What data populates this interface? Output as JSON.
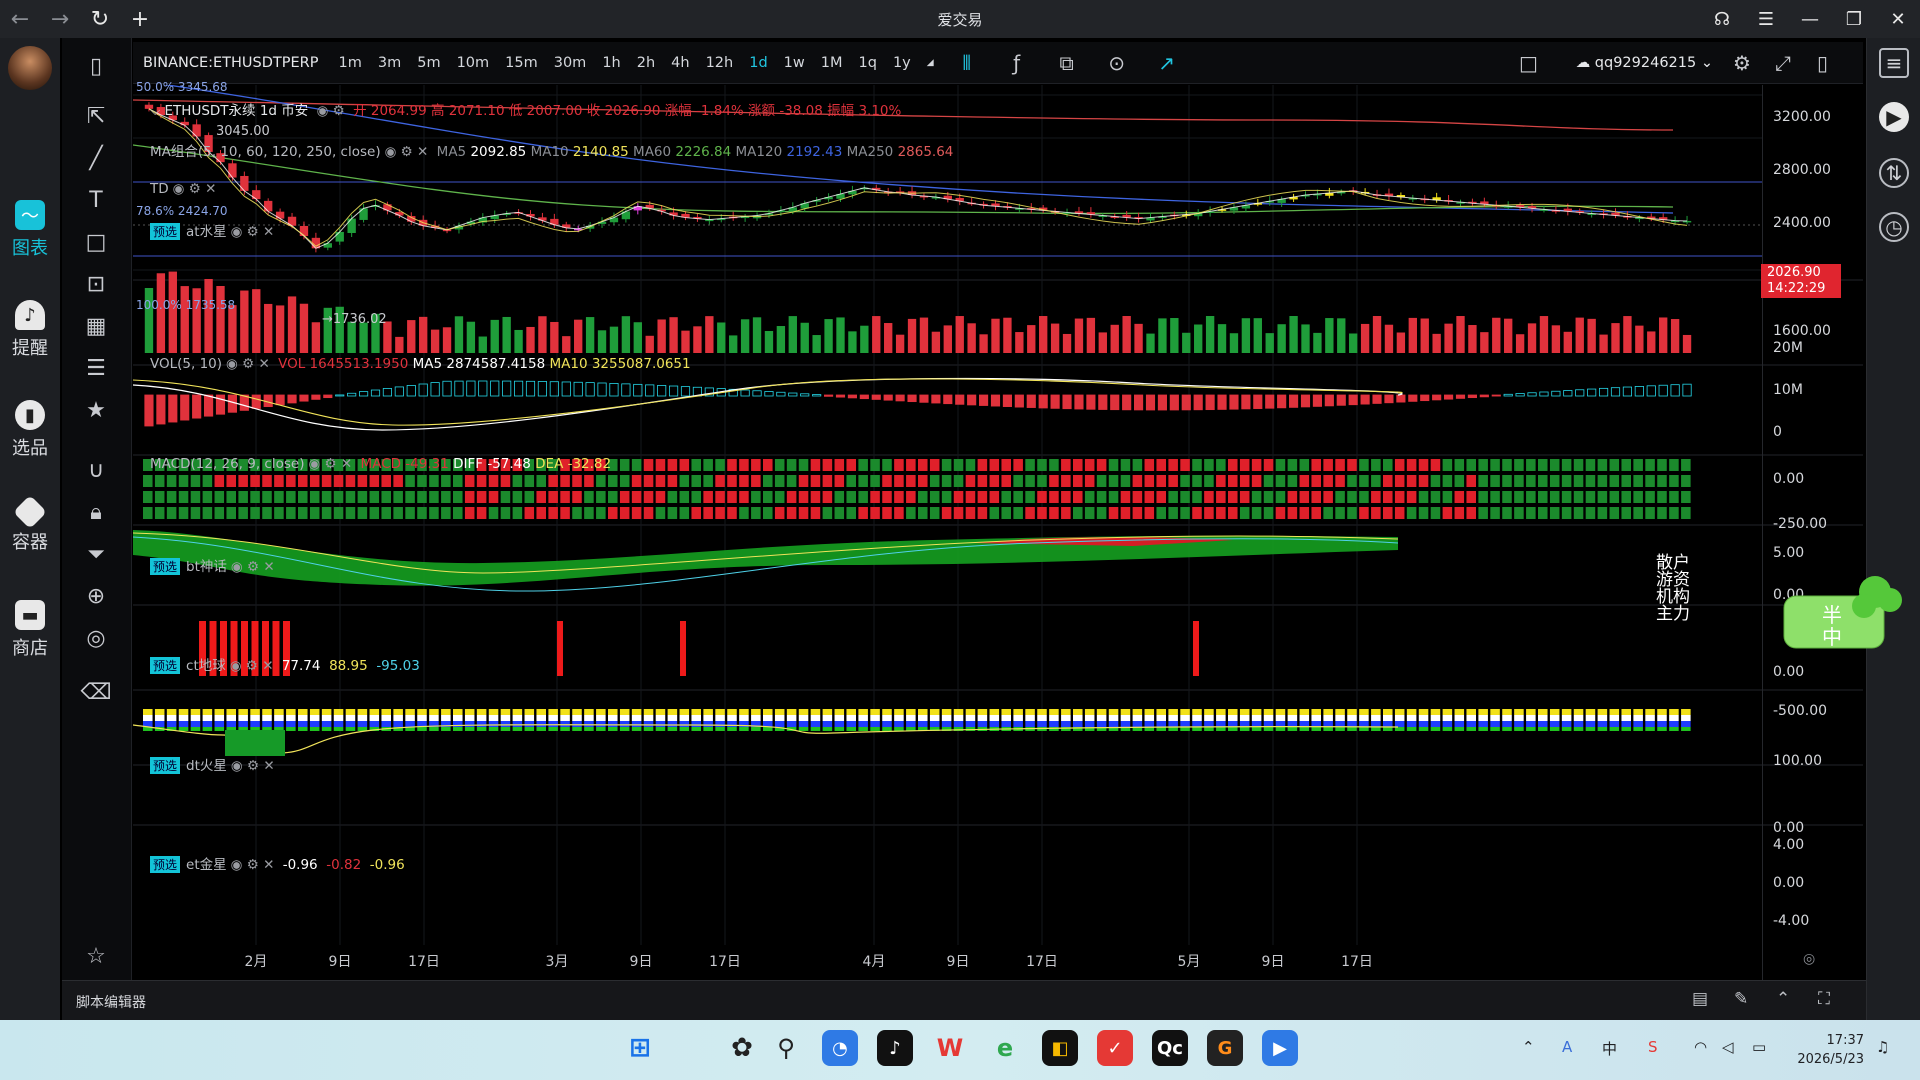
{
  "window": {
    "title": "爱交易"
  },
  "left_nav": [
    {
      "label": "图表",
      "icon": "chart-icon",
      "active": true
    },
    {
      "label": "提醒",
      "icon": "bell-icon",
      "active": false
    },
    {
      "label": "选品",
      "icon": "screener-icon",
      "active": false
    },
    {
      "label": "容器",
      "icon": "container-icon",
      "active": false
    },
    {
      "label": "商店",
      "icon": "store-icon",
      "active": false
    }
  ],
  "toolbar": {
    "symbol": "BINANCE:ETHUSDTPERP",
    "intervals": [
      "1m",
      "3m",
      "5m",
      "10m",
      "15m",
      "30m",
      "1h",
      "2h",
      "4h",
      "12h",
      "1d",
      "1w",
      "1M",
      "1q",
      "1y"
    ],
    "selected_interval": "1d",
    "user": "qq929246215"
  },
  "main_pane": {
    "legend": "ETHUSDT永续 1d 币安",
    "ohlc_text": "开 2064.99 高 2071.10 低 2007.00 收 2026.90 涨幅 -1.84% 涨额 -38.08 振幅 3.10%",
    "ma_group_label": "MA组合(5, 10, 60, 120, 250, close)",
    "ma_values": [
      {
        "name": "MA5",
        "value": "2092.85",
        "color": "#ffffff"
      },
      {
        "name": "MA10",
        "value": "2140.85",
        "color": "#f0e35a"
      },
      {
        "name": "MA60",
        "value": "2226.84",
        "color": "#5fb34b"
      },
      {
        "name": "MA120",
        "value": "2192.43",
        "color": "#3e64e0"
      },
      {
        "name": "MA250",
        "value": "2865.64",
        "color": "#e05a5a"
      }
    ],
    "td_label": "TD",
    "at_label": "at水星",
    "fib_top": "50.0% 3345.68",
    "fib_mid_price": "3045.00",
    "fib_786": "78.6% 2424.70",
    "fib_100": "100.0% 1735.58",
    "low_mark": "1736.02",
    "price_labels": [
      "3200.00",
      "2800.00",
      "2400.00",
      "1600.00"
    ],
    "last_price": "2026.90",
    "last_time": "14:22:29"
  },
  "vol_pane": {
    "label": "VOL(5, 10)",
    "vol_text": "VOL 1645513.1950",
    "ma5_text": "MA5 2874587.4158",
    "ma10_text": "MA10 3255087.0651",
    "axis": [
      "20M",
      "10M",
      "0"
    ]
  },
  "macd_pane": {
    "label": "MACD(12, 26, 9, close)",
    "macd_text": "MACD -49.31",
    "diff_text": "DIFF -57.48",
    "dea_text": "DEA -32.82",
    "axis": [
      "0.00",
      "-250.00"
    ]
  },
  "bt_pane": {
    "tag": "预选",
    "label": "bt神话",
    "axis": [
      "5.00",
      "0.00"
    ],
    "rows": [
      "散户",
      "游资",
      "机构",
      "主力"
    ]
  },
  "ct_pane": {
    "tag": "预选",
    "label": "ct地球",
    "v1": "77.74",
    "v2": "88.95",
    "v3": "-95.03",
    "axis": [
      "0.00",
      "-500.00"
    ]
  },
  "dt_pane": {
    "tag": "预选",
    "label": "dt火星",
    "axis": [
      "100.00",
      "0.00"
    ]
  },
  "et_pane": {
    "tag": "预选",
    "label": "et金星",
    "v1": "-0.96",
    "v2": "-0.82",
    "v3": "-0.96",
    "axis": [
      "4.00",
      "0.00",
      "-4.00"
    ]
  },
  "x_axis": [
    "2月",
    "9日",
    "17日",
    "3月",
    "9日",
    "17日",
    "4月",
    "9日",
    "17日",
    "5月",
    "9日",
    "17日"
  ],
  "bottom": {
    "label": "脚本编辑器"
  },
  "float_widget": {
    "text1": "半",
    "text2": "中"
  },
  "taskbar": {
    "time": "17:37",
    "date": "2026/5/23"
  },
  "colors": {
    "up": "#1f9d3a",
    "down": "#e0323c",
    "accent": "#18c2d9"
  },
  "chart_data": {
    "type": "candlestick",
    "symbol": "ETHUSDT永续",
    "interval": "1d",
    "ylim": [
      1500,
      3450
    ],
    "last": {
      "open": 2064.99,
      "high": 2071.1,
      "low": 2007.0,
      "close": 2026.9
    },
    "close_series": [
      3120,
      3060,
      3010,
      2960,
      2850,
      2700,
      2600,
      2450,
      2320,
      2240,
      2120,
      2050,
      1980,
      1880,
      1760,
      1810,
      1920,
      2050,
      2150,
      2180,
      2130,
      2080,
      2020,
      1980,
      1960,
      1940,
      1980,
      2020,
      2060,
      2080,
      2100,
      2110,
      2070,
      2030,
      1990,
      1960,
      1950,
      1980,
      2020,
      2060,
      2120,
      2170,
      2150,
      2120,
      2080,
      2060,
      2050,
      2040,
      2050,
      2060,
      2070,
      2080,
      2100,
      2130,
      2160,
      2200,
      2230,
      2260,
      2290,
      2320,
      2350,
      2330,
      2310,
      2300,
      2280,
      2270,
      2260,
      2240,
      2220,
      2200,
      2180,
      2170,
      2160,
      2150,
      2140,
      2130,
      2120,
      2110,
      2100,
      2090,
      2080,
      2070,
      2060,
      2050,
      2060,
      2070,
      2080,
      2090,
      2100,
      2120,
      2140,
      2160,
      2180,
      2200,
      2220,
      2240,
      2260,
      2280,
      2290,
      2300,
      2310,
      2320,
      2300,
      2280,
      2270,
      2260,
      2250,
      2240,
      2230,
      2220,
      2210,
      2200,
      2190,
      2180,
      2170,
      2160,
      2150,
      2140,
      2130,
      2120,
      2110,
      2100,
      2090,
      2080,
      2070,
      2060,
      2050,
      2040,
      2030,
      2027
    ]
  }
}
